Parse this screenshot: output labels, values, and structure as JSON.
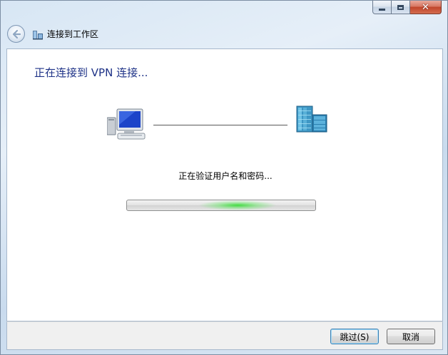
{
  "window": {
    "caption": {
      "minimize_icon": "minimize-icon",
      "maximize_icon": "maximize-icon",
      "close_icon": "close-icon",
      "close_glyph": "✕"
    },
    "header": {
      "back_icon": "back-arrow-icon",
      "network_icon": "workplace-network-icon",
      "title": "连接到工作区"
    }
  },
  "main": {
    "heading": "正在连接到 VPN 连接...",
    "computer_icon": "computer-icon",
    "server_icon": "server-icon",
    "status": "正在验证用户名和密码...",
    "progress": {
      "state": "indeterminate",
      "color": "#3cdc3c"
    }
  },
  "footer": {
    "skip_label": "跳过(S)",
    "cancel_label": "取消"
  },
  "colors": {
    "heading": "#1e3287",
    "close_button": "#c0452b",
    "window_frame": "#dbe7f3"
  }
}
